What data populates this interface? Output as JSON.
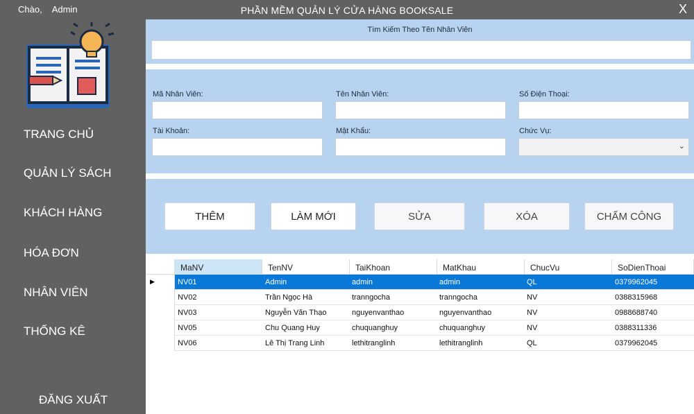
{
  "greeting": {
    "hello": "Chào,",
    "user": "Admin"
  },
  "app": {
    "title": "PHẦN MỀM QUẢN LÝ CỬA HÀNG BOOKSALE",
    "close": "X"
  },
  "nav": {
    "items": [
      "TRANG CHỦ",
      "QUẢN LÝ SÁCH",
      "KHÁCH HÀNG",
      "HÓA ĐƠN",
      "NHÂN VIÊN",
      "THỐNG KÊ"
    ],
    "logout": "ĐĂNG XUẤT"
  },
  "search": {
    "label": "Tìm Kiếm Theo Tên Nhân Viên",
    "value": ""
  },
  "form": {
    "employee_id": {
      "label": "Mã Nhân Viên:",
      "value": ""
    },
    "name": {
      "label": "Tên Nhân Viên:",
      "value": ""
    },
    "phone": {
      "label": "Số Điện Thoại:",
      "value": ""
    },
    "account": {
      "label": "Tài Khoản:",
      "value": ""
    },
    "password": {
      "label": "Mật Khẩu:",
      "value": ""
    },
    "role": {
      "label": "Chức Vụ:",
      "value": ""
    }
  },
  "buttons": {
    "add": "THÊM",
    "refresh": "LÀM MỚI",
    "edit": "SỬA",
    "delete": "XÓA",
    "attendance": "CHẤM CÔNG"
  },
  "table": {
    "columns": [
      "MaNV",
      "TenNV",
      "TaiKhoan",
      "MatKhau",
      "ChucVu",
      "SoDienThoai"
    ],
    "rows": [
      [
        "NV01",
        "Admin",
        "admin",
        "admin",
        "QL",
        "0379962045"
      ],
      [
        "NV02",
        "Trần Ngọc Hà",
        "tranngocha",
        "tranngocha",
        "NV",
        "0388315968"
      ],
      [
        "NV03",
        "Nguyễn Văn Thạo",
        "nguyenvanthao",
        "nguyenvanthao",
        "NV",
        "0988688740"
      ],
      [
        "NV05",
        "Chu Quang Huy",
        "chuquanghuy",
        "chuquanghuy",
        "NV",
        "0388311336"
      ],
      [
        "NV06",
        "Lê Thị Trang Linh",
        "lethitranglinh",
        "lethitranglinh",
        "QL",
        "0379962045"
      ]
    ],
    "selected_row": 0
  },
  "colors": {
    "sidebar": "#616161",
    "panel": "#b8d3ef",
    "selection": "#0a78d7"
  }
}
